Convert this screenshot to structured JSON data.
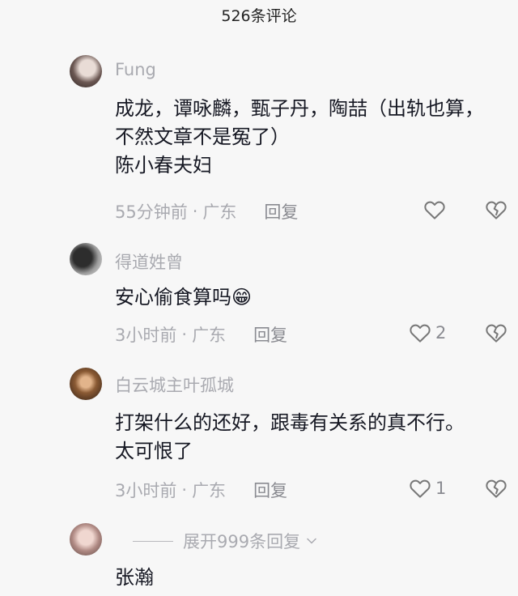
{
  "header": {
    "title": "526条评论"
  },
  "comments": [
    {
      "username": "Fung",
      "lines": [
        "成龙，谭咏麟，甄子丹，陶喆（出轨也算，",
        "不然文章不是冤了）",
        "陈小春夫妇"
      ],
      "time": "55分钟前",
      "location": "广东",
      "reply_label": "回复",
      "likes": ""
    },
    {
      "username": "得道姓曾",
      "lines": [
        "安心偷食算吗😁"
      ],
      "time": "3小时前",
      "location": "广东",
      "reply_label": "回复",
      "likes": "2"
    },
    {
      "username": "白云城主叶孤城",
      "lines": [
        "打架什么的还好，跟毒有关系的真不行。",
        "太可恨了"
      ],
      "time": "3小时前",
      "location": "广东",
      "reply_label": "回复",
      "likes": "1"
    },
    {
      "username": "",
      "lines": [
        "张瀚"
      ],
      "time": "",
      "location": "",
      "reply_label": "",
      "likes": ""
    }
  ],
  "expand_replies": {
    "label": "展开999条回复"
  },
  "separator": "·",
  "colors": {
    "text": "#161823",
    "secondary": "#a9aab0",
    "background": "#f7f7f7"
  }
}
